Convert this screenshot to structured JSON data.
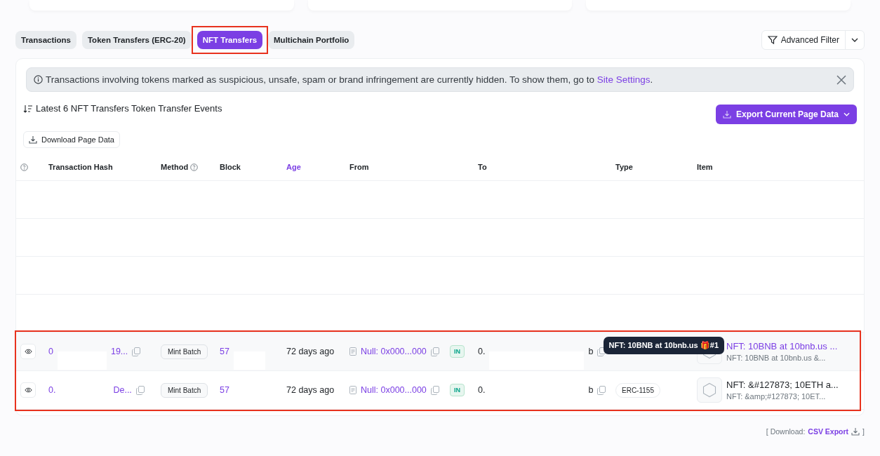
{
  "tabs": [
    {
      "label": "Transactions",
      "selected": false
    },
    {
      "label": "Token Transfers (ERC-20)",
      "selected": false
    },
    {
      "label": "NFT Transfers",
      "selected": true
    },
    {
      "label": "Multichain Portfolio",
      "selected": false
    }
  ],
  "filter": {
    "label": "Advanced Filter"
  },
  "notice": {
    "text": "Transactions involving tokens marked as suspicious, unsafe, spam or brand infringement are currently hidden. To show them, go to ",
    "link": "Site Settings",
    "end": "."
  },
  "summary": "Latest 6 NFT Transfers Token Transfer Events",
  "export_button": "Export Current Page Data",
  "download_button": "Download Page Data",
  "columns": [
    {
      "label": "Transaction Hash",
      "help": false,
      "sorted": false
    },
    {
      "label": "Method",
      "help": true,
      "sorted": false
    },
    {
      "label": "Block",
      "help": false,
      "sorted": false
    },
    {
      "label": "Age",
      "help": false,
      "sorted": true
    },
    {
      "label": "From",
      "help": false,
      "sorted": false
    },
    {
      "label": "To",
      "help": false,
      "sorted": false
    },
    {
      "label": "Type",
      "help": false,
      "sorted": false
    },
    {
      "label": "Item",
      "help": false,
      "sorted": false
    }
  ],
  "rows": [
    {
      "hash_start": "0",
      "hash_end": "19...",
      "method": "Mint Batch",
      "block": "57",
      "age": "72 days ago",
      "from": "Null: 0x000...000",
      "direction": "IN",
      "to_start": "0.",
      "to_end": "b",
      "type": null,
      "item_title": "NFT: 10BNB at 10bnb.us ...",
      "item_sub": "NFT: 10BNB at 10bnb.us &...",
      "item_link": true,
      "tooltip": "NFT: 10BNB at 10bnb.us 🎁#1"
    },
    {
      "hash_start": "0.",
      "hash_end": "De...",
      "method": "Mint Batch",
      "block": "57",
      "age": "72 days ago",
      "from": "Null: 0x000...000",
      "direction": "IN",
      "to_start": "0.",
      "to_end": "b",
      "type": "ERC-1155",
      "item_title": "NFT: &#127873; 10ETH a...",
      "item_sub": "NFT: &amp;#127873; 10ET...",
      "item_link": false,
      "tooltip": null
    }
  ],
  "footer": {
    "label": "[ Download:",
    "link": "CSV Export",
    "end": "]"
  }
}
